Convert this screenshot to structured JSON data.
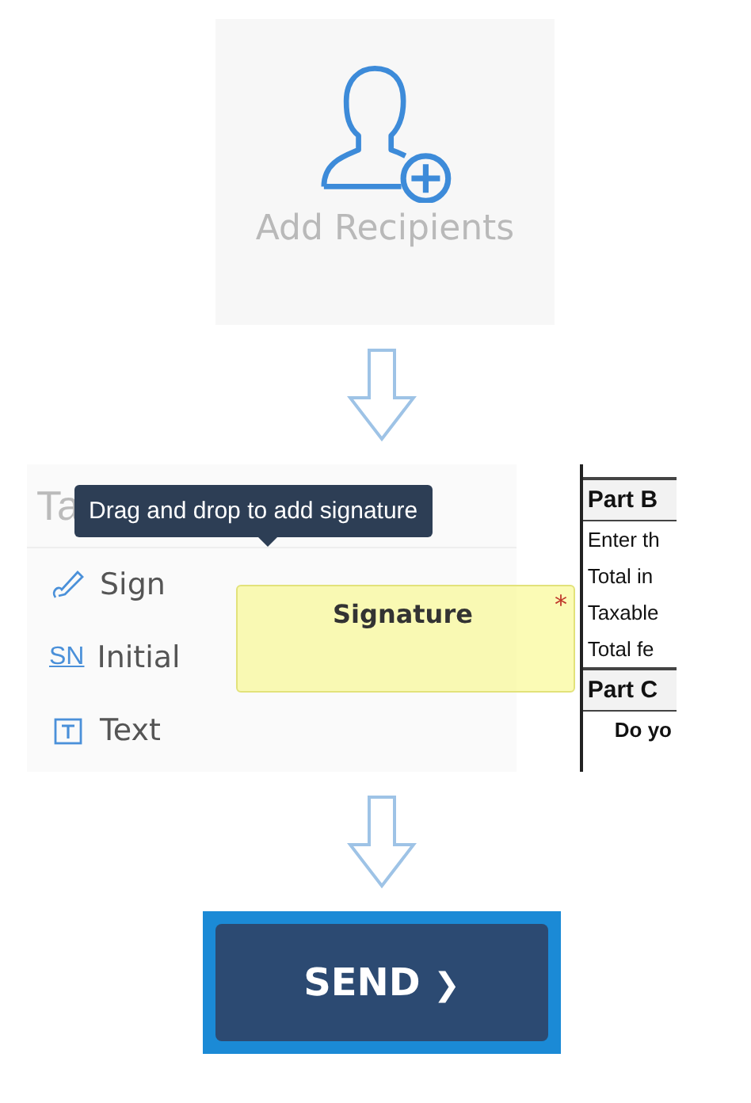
{
  "recipients_card": {
    "label": "Add Recipients"
  },
  "fields_panel": {
    "search_placeholder": "Ta",
    "tooltip": "Drag and drop to add signature",
    "tools": [
      {
        "kind": "sign",
        "label": "Sign"
      },
      {
        "kind": "initial",
        "icon_text": "SN",
        "label": "Initial"
      },
      {
        "kind": "text",
        "label": "Text"
      }
    ],
    "signature_field": {
      "label": "Signature",
      "required_mark": "*"
    }
  },
  "document": {
    "rows": [
      {
        "kind": "heading",
        "text": "Part B"
      },
      {
        "kind": "line",
        "text": "Enter th"
      },
      {
        "kind": "line",
        "text": "Total in"
      },
      {
        "kind": "line",
        "text": "Taxable"
      },
      {
        "kind": "line",
        "text": "Total fe"
      },
      {
        "kind": "heading",
        "text": "Part C"
      },
      {
        "kind": "question",
        "text": "Do yo"
      }
    ]
  },
  "send_button": {
    "label": "SEND",
    "icon": "❯"
  }
}
